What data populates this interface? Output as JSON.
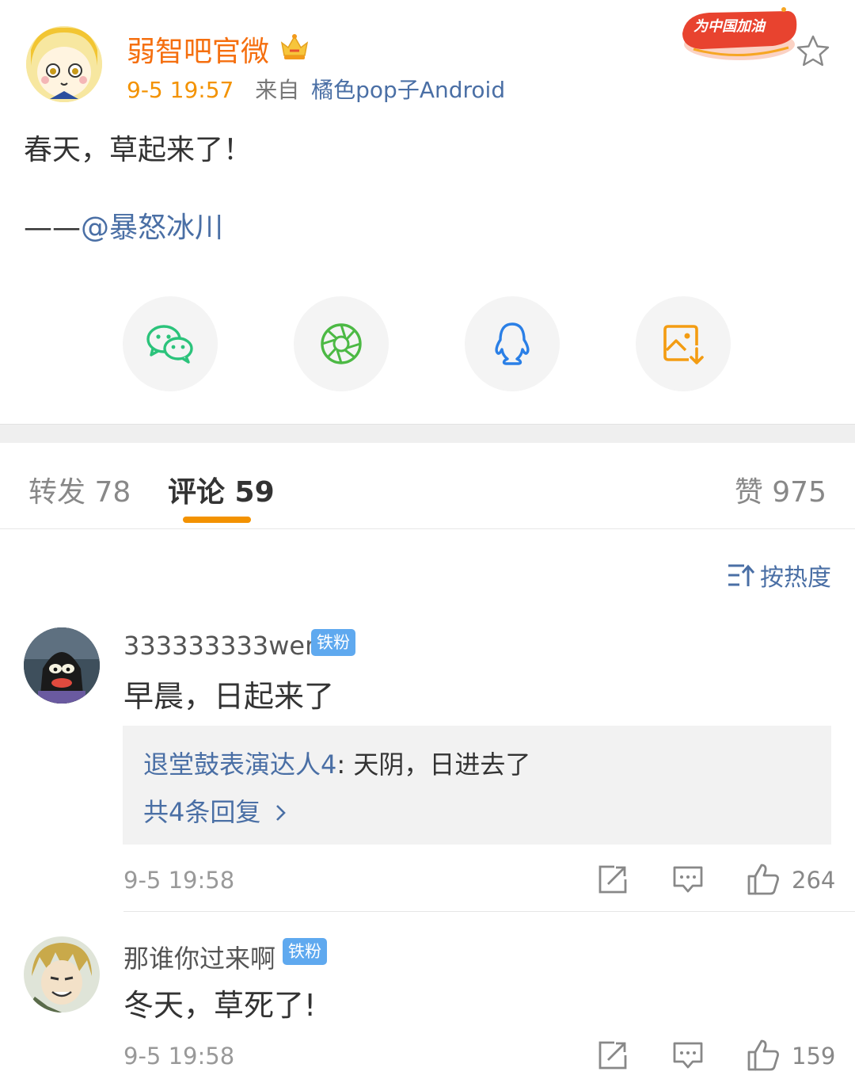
{
  "post": {
    "author": "弱智吧官微",
    "time": "9-5 19:57",
    "from_label": "来自",
    "source": "橘色pop子Android",
    "badge_text": "为中国加油",
    "text": "春天，草起来了！",
    "mention_prefix": "——",
    "mention": "@暴怒冰川"
  },
  "share": [
    "wechat-icon",
    "moments-icon",
    "qq-icon",
    "save-image-icon"
  ],
  "tabs": {
    "repost": "转发 78",
    "comments": "评论 59",
    "likes": "赞 975"
  },
  "sort_label": "按热度",
  "comments": [
    {
      "user": "333333333wer",
      "badge": "铁粉",
      "text": "早晨，日起来了",
      "reply": {
        "user": "退堂鼓表演达人4",
        "separator": ": ",
        "text": "天阴，日进去了",
        "more": "共4条回复 "
      },
      "time": "9-5 19:58",
      "likes": "264"
    },
    {
      "user": "那谁你过来啊",
      "badge": "铁粉",
      "text": "冬天，草死了!",
      "time": "9-5 19:58",
      "likes": "159"
    }
  ],
  "colors": {
    "accent": "#f39200",
    "author": "#f56f0f",
    "link": "#4a6fa5",
    "badge": "#5fa9ef"
  }
}
